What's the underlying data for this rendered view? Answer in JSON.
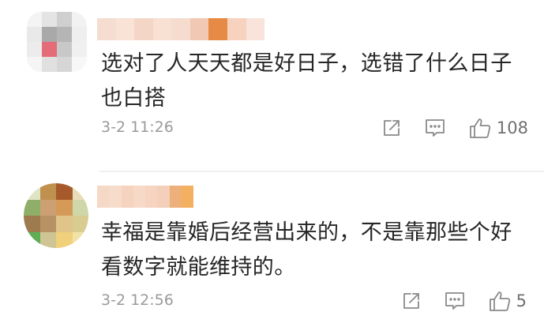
{
  "comments": [
    {
      "nickname_colors": [
        "#f6ddd2",
        "#f9e2d6",
        "#f4d6c7",
        "#f8e0d3",
        "#f6dccf",
        "#f0c8b4",
        "#e68a45",
        "#f6d2bf",
        "#f8e4da"
      ],
      "avatar_colors": [
        "#f4f4f4",
        "#e4e4e4",
        "#cfcfcf",
        "#f2f2f2",
        "#e9e9e9",
        "#a9a9a9",
        "#b5b5b5",
        "#efefef",
        "#ececec",
        "#e46c78",
        "#c8c8c8",
        "#f0f0f0",
        "#f5f5f5",
        "#e0e0e0",
        "#d6d6d6",
        "#f7f7f7"
      ],
      "text": "选对了人天天都是好日子，选错了什么日子也白搭",
      "time": "3-2 11:26",
      "likes": "108"
    },
    {
      "nickname_colors": [
        "#f6d8c6",
        "#f8dccb",
        "#f5d3bf",
        "#f7d9c7",
        "#f6d4c1",
        "#f4cfba",
        "#eeb07a",
        "#f3b060"
      ],
      "avatar_colors": [
        "#dfe4c4",
        "#c0904f",
        "#a65a2c",
        "#e8ddb8",
        "#8fae6a",
        "#cda074",
        "#d59a58",
        "#cfd6a8",
        "#9e7a4f",
        "#b69265",
        "#e0c48a",
        "#d8cc90",
        "#5fae54",
        "#cfc494",
        "#f0d07a",
        "#f2e2a8"
      ],
      "text": "幸福是靠婚后经营出来的，不是靠那些个好看数字就能维持的。",
      "time": "3-2 12:56",
      "likes": "5"
    }
  ],
  "icons": {
    "share": "share-icon",
    "reply": "comment-icon",
    "like": "thumbs-up-icon"
  }
}
